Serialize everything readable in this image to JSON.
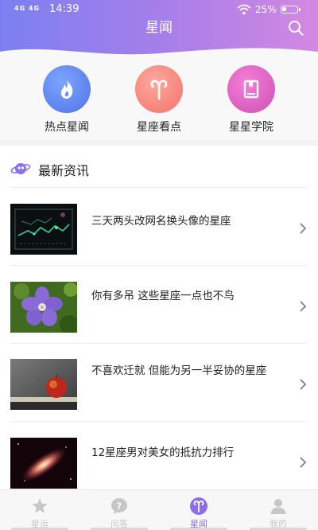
{
  "status_bar": {
    "signal": "4G 4G",
    "time": "14:39",
    "battery": "25%"
  },
  "header": {
    "title": "星闻",
    "icons": {
      "search": "search-icon"
    }
  },
  "colors": {
    "header_gradient": [
      "#7c7ff2",
      "#d488e2"
    ],
    "accent": "#8c6ee8",
    "hot": "#5b82ee",
    "zodiac": "#f4837a",
    "academy": "#d853b8"
  },
  "quick_links": [
    {
      "label": "热点星闻",
      "icon": "flame-icon"
    },
    {
      "label": "星座看点",
      "icon": "aries-icon"
    },
    {
      "label": "星星学院",
      "icon": "book-icon"
    }
  ],
  "news": {
    "section_title": "最新资讯",
    "section_icon": "planet-icon",
    "items": [
      {
        "title": "三天两头改网名换头像的星座",
        "thumb": "circuit-art-thumbnail"
      },
      {
        "title": "你有多吊 这些星座一点也不鸟",
        "thumb": "purple-flower-thumbnail"
      },
      {
        "title": "不喜欢迁就 但能为另一半妥协的星座",
        "thumb": "apple-on-books-thumbnail"
      },
      {
        "title": "12星座男对美女的抵抗力排行",
        "thumb": "galaxy-thumbnail"
      }
    ]
  },
  "tabbar": {
    "tabs": [
      {
        "label": "星运",
        "icon": "star-icon"
      },
      {
        "label": "问答",
        "icon": "question-icon"
      },
      {
        "label": "星闻",
        "icon": "aries-icon",
        "active": true
      },
      {
        "label": "我的",
        "icon": "user-icon"
      }
    ]
  }
}
